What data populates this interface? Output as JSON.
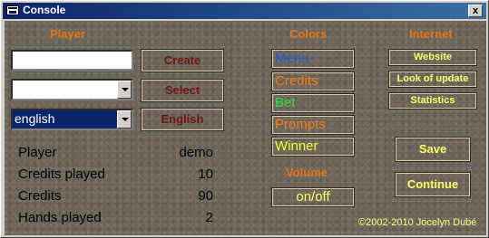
{
  "window": {
    "title": "Console",
    "close_label": "x"
  },
  "player_section": {
    "header": "Player",
    "name_input": "",
    "select_value": "",
    "language_value": "english",
    "create_label": "Create",
    "select_label": "Select",
    "language_label": "English"
  },
  "stats": [
    {
      "label": "Player",
      "value": "demo"
    },
    {
      "label": "Credits played",
      "value": "10"
    },
    {
      "label": "Credits",
      "value": "90"
    },
    {
      "label": "Hands played",
      "value": "2"
    }
  ],
  "colors_section": {
    "header": "Colors",
    "items": [
      {
        "label": "Menu",
        "color": "#1e5bd6"
      },
      {
        "label": "Credits",
        "color": "#ff7a1a"
      },
      {
        "label": "Bet",
        "color": "#2fe04a"
      },
      {
        "label": "Prompts",
        "color": "#ff7a1a"
      },
      {
        "label": "Winner",
        "color": "#ffff30"
      }
    ]
  },
  "volume_section": {
    "header": "Volume",
    "toggle_label": "on/off"
  },
  "internet_section": {
    "header": "Internet",
    "website_label": "Website",
    "update_label": "Look of update",
    "statistics_label": "Statistics"
  },
  "actions": {
    "save_label": "Save",
    "continue_label": "Continue"
  },
  "footer": {
    "copyright": "©2002-2010 Jocelyn Dubé"
  }
}
